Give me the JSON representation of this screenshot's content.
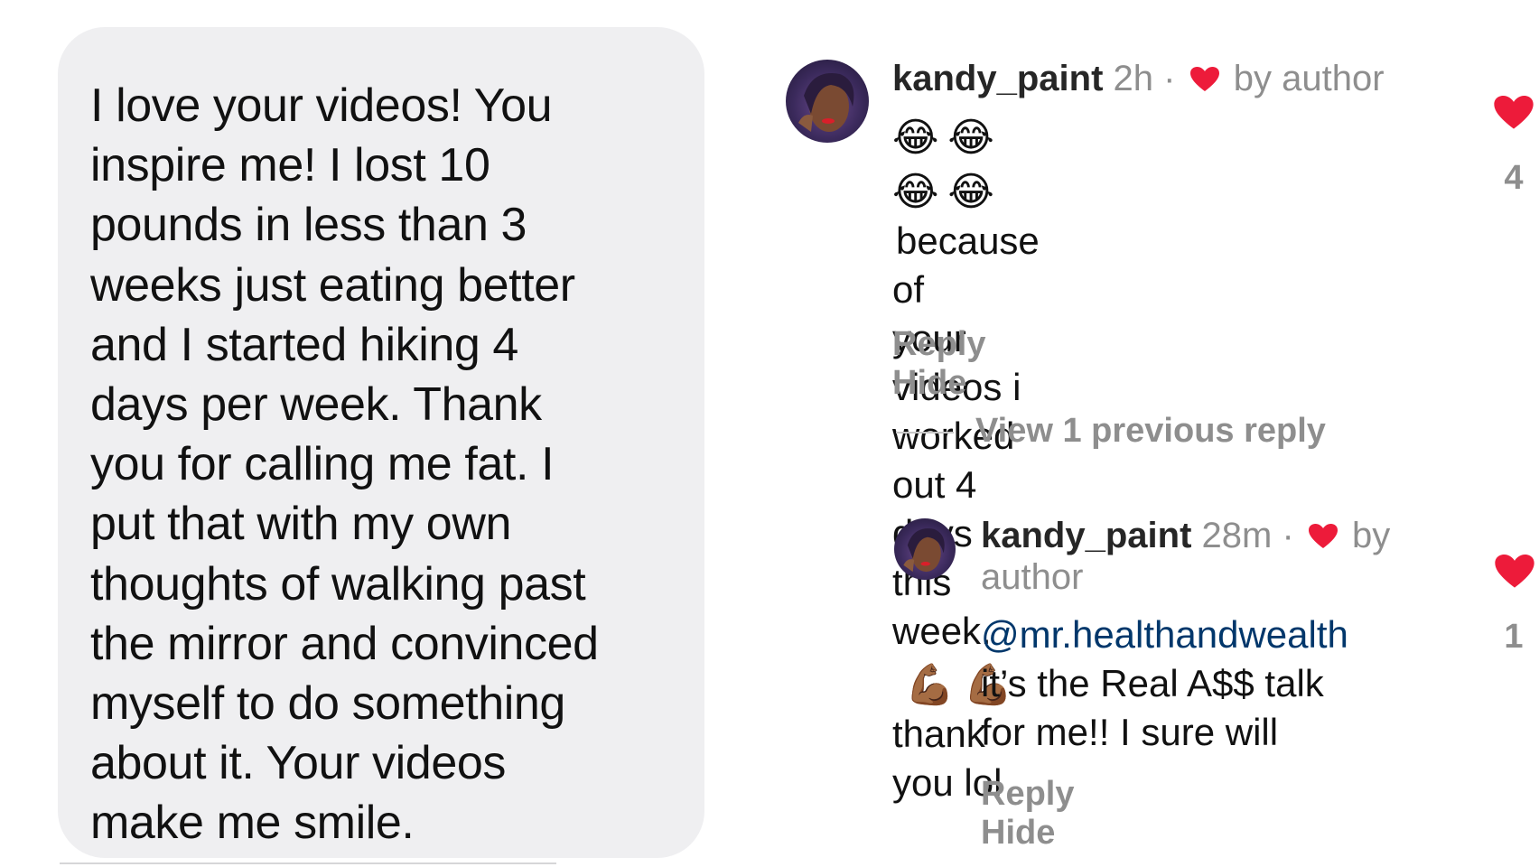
{
  "dm_message": {
    "text": "I love your videos! You\ninspire me! I lost 10\npounds in less than 3\nweeks just eating better\nand I started hiking 4\ndays per week. Thank\nyou for calling me fat. I\nput that with my own\nthoughts of walking past\nthe mirror and convinced\nmyself to do something\nabout it. Your videos\nmake me smile."
  },
  "comments": [
    {
      "username": "kandy_paint",
      "time": "2h",
      "separator": "·",
      "author_label": "by author",
      "emoji_laughing": "😂",
      "emoji_muscle": "💪🏾",
      "text_after_emoji": "because of",
      "text_lines": "your videos i worked out 4",
      "text_line3": "days this week.",
      "text_line4": "thank you lol",
      "reply_label": "Reply",
      "hide_label": "Hide",
      "like_count": "4"
    },
    {
      "username": "kandy_paint",
      "time": "28m",
      "separator": "·",
      "author_label_1": "by",
      "author_label_2": "author",
      "mention": "@mr.healthandwealth",
      "text_line2": "it’s the Real A$$ talk",
      "text_line3": "for me!! I sure will",
      "reply_label": "Reply",
      "hide_label": "Hide",
      "like_count": "1"
    }
  ],
  "view_previous_reply": "View 1 previous reply",
  "colors": {
    "heart": "#ed1b3a",
    "mention": "#00376b",
    "muted": "#8e8e8e",
    "bubble": "#efeff1"
  },
  "icons": {
    "heart": "heart-icon",
    "avatar": "profile-avatar"
  }
}
